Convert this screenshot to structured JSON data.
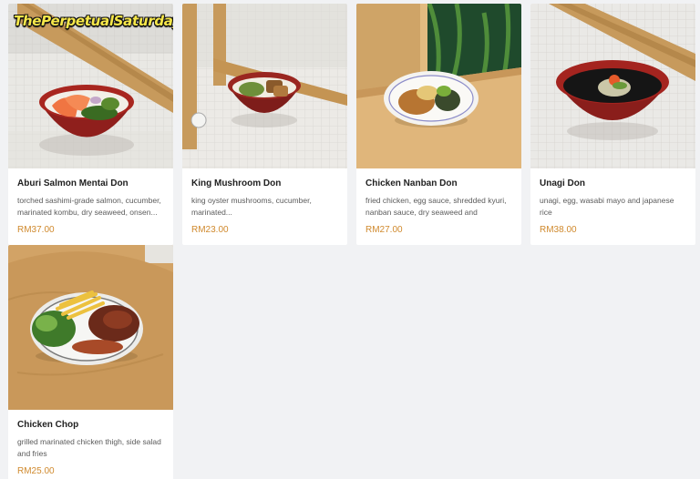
{
  "watermark": "ThePerpetualSaturday",
  "menu_items": [
    {
      "name": "Aburi Salmon Mentai Don",
      "description": "torched sashimi-grade salmon, cucumber, marinated kombu, dry seaweed, onsen...",
      "price": "RM37.00",
      "image": "salmon-bowl-photo"
    },
    {
      "name": "King Mushroom Don",
      "description": "king oyster mushrooms, cucumber, marinated...",
      "price": "RM23.00",
      "image": "mushroom-bowl-photo"
    },
    {
      "name": "Chicken Nanban Don",
      "description": "fried chicken, egg sauce, shredded kyuri, nanban sauce, dry seaweed and japanese...",
      "price": "RM27.00",
      "image": "chicken-nanban-photo"
    },
    {
      "name": "Unagi Don",
      "description": "unagi, egg, wasabi mayo and japanese rice",
      "price": "RM38.00",
      "image": "unagi-bowl-photo"
    },
    {
      "name": "Chicken Chop",
      "description": "grilled marinated chicken thigh, side salad and fries",
      "price": "RM25.00",
      "image": "chicken-chop-photo"
    }
  ],
  "colors": {
    "background": "#f1f2f4",
    "price": "#d08a2e",
    "card": "#ffffff"
  }
}
